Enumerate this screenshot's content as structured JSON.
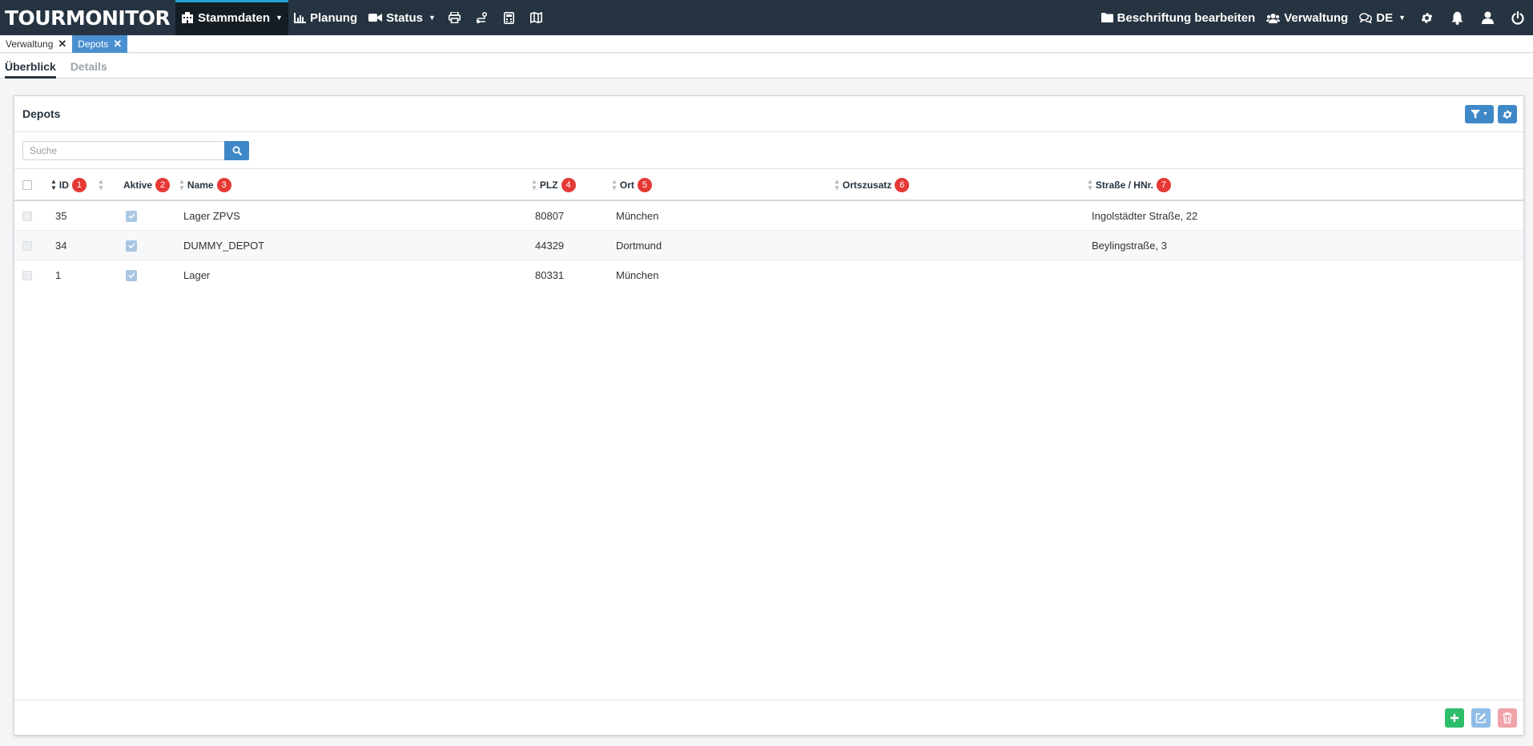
{
  "app": {
    "brand": "TOURMONITOR"
  },
  "nav": {
    "stammdaten": "Stammdaten",
    "planung": "Planung",
    "status": "Status",
    "beschriftung": "Beschriftung bearbeiten",
    "verwaltung": "Verwaltung",
    "language": "DE"
  },
  "window_tabs": [
    {
      "label": "Verwaltung",
      "close": "✕",
      "active": false
    },
    {
      "label": "Depots",
      "close": "✕",
      "active": true
    }
  ],
  "subtabs": {
    "overview": "Überblick",
    "details": "Details"
  },
  "panel": {
    "title": "Depots"
  },
  "search": {
    "placeholder": "Suche",
    "value": ""
  },
  "table": {
    "columns": [
      {
        "label": "ID",
        "badge": "1"
      },
      {
        "label": "Aktive",
        "badge": "2"
      },
      {
        "label": "Name",
        "badge": "3"
      },
      {
        "label": "PLZ",
        "badge": "4"
      },
      {
        "label": "Ort",
        "badge": "5"
      },
      {
        "label": "Ortszusatz",
        "badge": "6"
      },
      {
        "label": "Straße / HNr.",
        "badge": "7"
      }
    ],
    "rows": [
      {
        "id": "35",
        "active": true,
        "name": "Lager ZPVS",
        "plz": "80807",
        "ort": "München",
        "ortszusatz": "",
        "strasse": "Ingolstädter Straße, 22"
      },
      {
        "id": "34",
        "active": true,
        "name": "DUMMY_DEPOT",
        "plz": "44329",
        "ort": "Dortmund",
        "ortszusatz": "",
        "strasse": "Beylingstraße, 3"
      },
      {
        "id": "1",
        "active": true,
        "name": "Lager",
        "plz": "80331",
        "ort": "München",
        "ortszusatz": "",
        "strasse": ""
      }
    ]
  },
  "colors": {
    "navbar": "#263441",
    "nav_active_accent": "#21a1d4",
    "primary": "#3f88c7",
    "badge": "#e53935",
    "add": "#2ebd6b",
    "edit": "#8fbde6",
    "delete": "#f0a3a8"
  },
  "icons": [
    "building-icon",
    "chart-icon",
    "video-icon",
    "print-icon",
    "route-icon",
    "calculator-icon",
    "map-icon",
    "folder-icon",
    "users-icon",
    "chat-icon",
    "gear-icon",
    "bell-icon",
    "user-icon",
    "power-icon",
    "filter-icon",
    "search-icon",
    "plus-icon",
    "edit-icon",
    "trash-icon"
  ]
}
